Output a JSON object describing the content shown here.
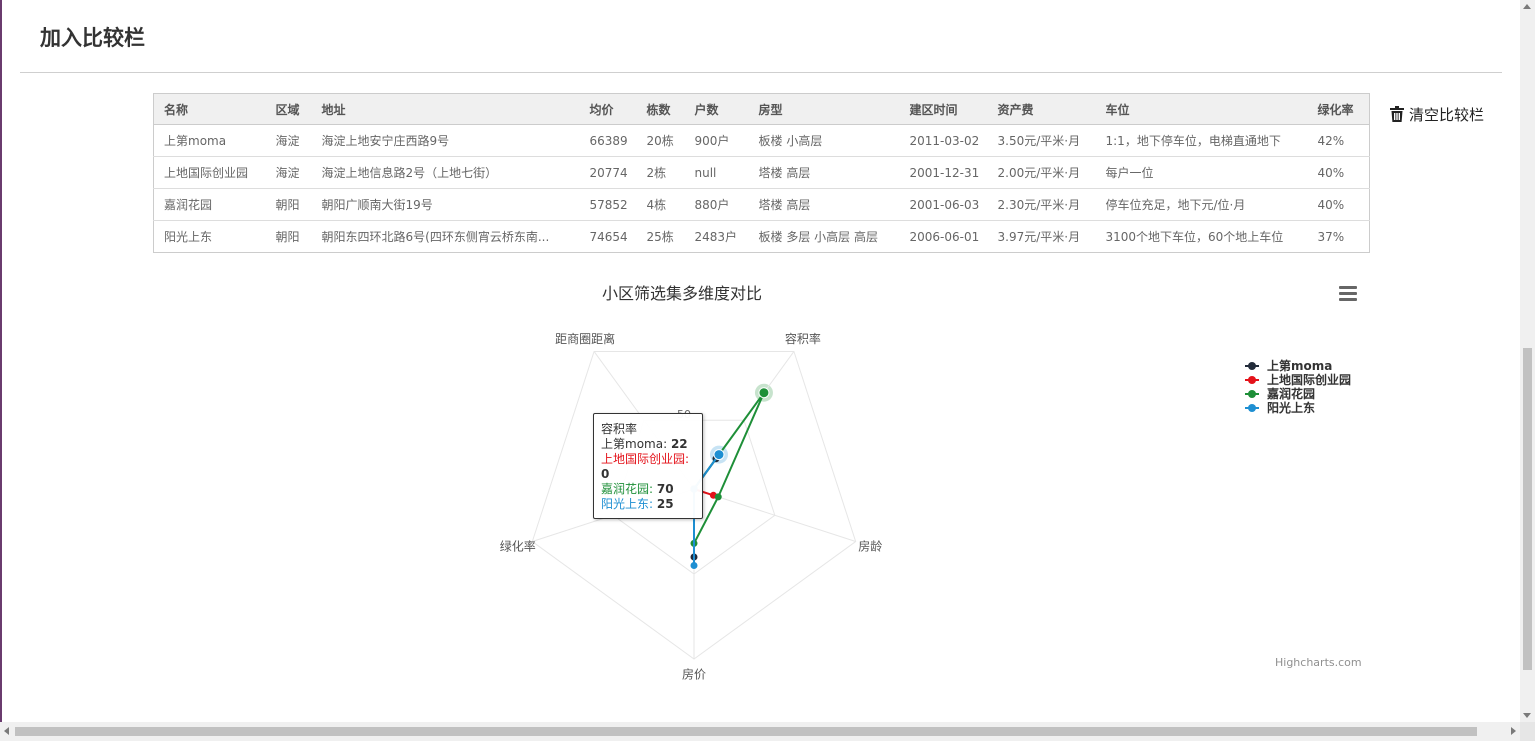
{
  "page": {
    "title": "加入比较栏",
    "clear_label": "清空比较栏"
  },
  "table": {
    "headers": [
      "名称",
      "区域",
      "地址",
      "均价",
      "栋数",
      "户数",
      "房型",
      "建区时间",
      "资产费",
      "车位",
      "绿化率"
    ],
    "rows": [
      [
        "上第moma",
        "海淀",
        "海淀上地安宁庄西路9号",
        "66389",
        "20栋",
        "900户",
        "板楼 小高层",
        "2011-03-02",
        "3.50元/平米·月",
        "1:1，地下停车位，电梯直通地下",
        "42%"
      ],
      [
        "上地国际创业园",
        "海淀",
        "海淀上地信息路2号（上地七街）",
        "20774",
        "2栋",
        "null",
        "塔楼 高层",
        "2001-12-31",
        "2.00元/平米·月",
        "每户一位",
        "40%"
      ],
      [
        "嘉润花园",
        "朝阳",
        "朝阳广顺南大街19号",
        "57852",
        "4栋",
        "880户",
        "塔楼 高层",
        "2001-06-03",
        "2.30元/平米·月",
        "停车位充足，地下元/位·月",
        "40%"
      ],
      [
        "阳光上东",
        "朝阳",
        "朝阳东四环北路6号(四环东侧宵云桥东南...",
        "74654",
        "25栋",
        "2483户",
        "板楼 多层 小高层 高层",
        "2006-06-01",
        "3.97元/平米·月",
        "3100个地下车位，60个地上车位",
        "37%"
      ]
    ]
  },
  "chart": {
    "menu_icon": "hamburger-menu-icon",
    "credit": "Highcharts.com",
    "tooltip": {
      "header": "容积率",
      "items": [
        {
          "label": "上第moma:",
          "value": "22",
          "color": "#333333"
        },
        {
          "label": "上地国际创业园:",
          "value": "0",
          "color": "#e4121a"
        },
        {
          "label": "嘉润花园:",
          "value": "70",
          "color": "#1e8f38"
        },
        {
          "label": "阳光上东:",
          "value": "25",
          "color": "#1e8fd2"
        }
      ]
    }
  },
  "chart_data": {
    "type": "radar",
    "title": "小区筛选集多维度对比",
    "categories": [
      "容积率",
      "房龄",
      "房价",
      "绿化率",
      "距商圈距离"
    ],
    "ylim": [
      0,
      100
    ],
    "tick_labels": [
      "50"
    ],
    "grid": true,
    "legend_position": "right",
    "series": [
      {
        "name": "上第moma",
        "color": "#222b3a",
        "values": [
          22,
          0,
          40,
          0,
          0
        ]
      },
      {
        "name": "上地国际创业园",
        "color": "#e4121a",
        "values": [
          0,
          12,
          0,
          0,
          0
        ]
      },
      {
        "name": "嘉润花园",
        "color": "#1e8f38",
        "values": [
          70,
          15,
          32,
          0,
          0
        ]
      },
      {
        "name": "阳光上东",
        "color": "#1e8fd2",
        "values": [
          25,
          0,
          45,
          0,
          0
        ]
      }
    ]
  }
}
